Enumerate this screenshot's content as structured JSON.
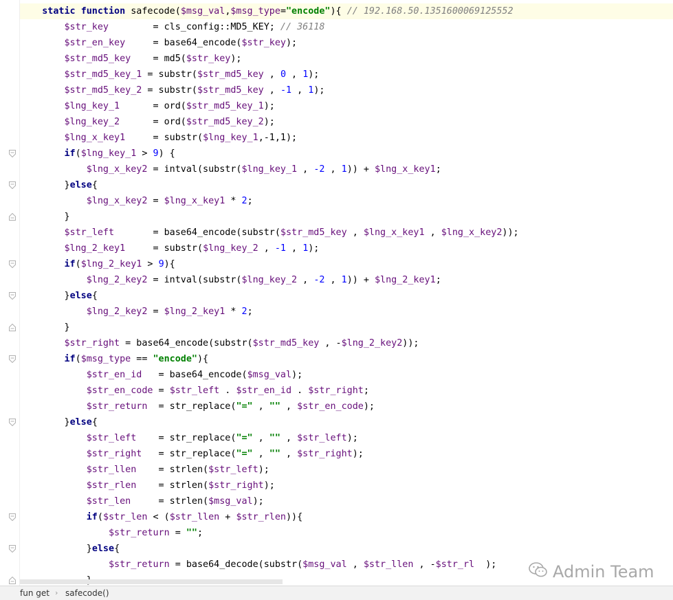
{
  "editor": {
    "lines": [
      {
        "indent": "    ",
        "tokens": [
          {
            "t": "static",
            "c": "kw"
          },
          {
            "t": " "
          },
          {
            "t": "function",
            "c": "kw"
          },
          {
            "t": " safecode("
          },
          {
            "t": "$msg_val",
            "c": "var"
          },
          {
            "t": ","
          },
          {
            "t": "$msg_type",
            "c": "var"
          },
          {
            "t": "="
          },
          {
            "t": "\"encode\"",
            "c": "str"
          },
          {
            "t": "){ "
          },
          {
            "t": "// 192.168.50.1351600069125552",
            "c": "cmt"
          }
        ]
      },
      {
        "indent": "        ",
        "tokens": [
          {
            "t": "$str_key",
            "c": "var"
          },
          {
            "t": "        = cls_config::MD5_KEY; "
          },
          {
            "t": "// 36118",
            "c": "cmt"
          }
        ]
      },
      {
        "indent": "        ",
        "tokens": [
          {
            "t": "$str_en_key",
            "c": "var"
          },
          {
            "t": "     = base64_encode("
          },
          {
            "t": "$str_key",
            "c": "var"
          },
          {
            "t": ");"
          }
        ]
      },
      {
        "indent": "        ",
        "tokens": [
          {
            "t": "$str_md5_key",
            "c": "var"
          },
          {
            "t": "    = md5("
          },
          {
            "t": "$str_key",
            "c": "var"
          },
          {
            "t": ");"
          }
        ]
      },
      {
        "indent": "        ",
        "tokens": [
          {
            "t": "$str_md5_key_1",
            "c": "var"
          },
          {
            "t": " = substr("
          },
          {
            "t": "$str_md5_key",
            "c": "var"
          },
          {
            "t": " , "
          },
          {
            "t": "0",
            "c": "num"
          },
          {
            "t": " , "
          },
          {
            "t": "1",
            "c": "num"
          },
          {
            "t": ");"
          }
        ]
      },
      {
        "indent": "        ",
        "tokens": [
          {
            "t": "$str_md5_key_2",
            "c": "var"
          },
          {
            "t": " = substr("
          },
          {
            "t": "$str_md5_key",
            "c": "var"
          },
          {
            "t": " , "
          },
          {
            "t": "-1",
            "c": "num"
          },
          {
            "t": " , "
          },
          {
            "t": "1",
            "c": "num"
          },
          {
            "t": ");"
          }
        ]
      },
      {
        "indent": "        ",
        "tokens": [
          {
            "t": "$lng_key_1",
            "c": "var"
          },
          {
            "t": "      = ord("
          },
          {
            "t": "$str_md5_key_1",
            "c": "var"
          },
          {
            "t": ");"
          }
        ]
      },
      {
        "indent": "        ",
        "tokens": [
          {
            "t": "$lng_key_2",
            "c": "var"
          },
          {
            "t": "      = ord("
          },
          {
            "t": "$str_md5_key_2",
            "c": "var"
          },
          {
            "t": ");"
          }
        ]
      },
      {
        "indent": "        ",
        "tokens": [
          {
            "t": "$lng_x_key1",
            "c": "var"
          },
          {
            "t": "     = substr("
          },
          {
            "t": "$lng_key_1",
            "c": "var"
          },
          {
            "t": ",-1,1);"
          }
        ]
      },
      {
        "indent": "        ",
        "fold": "open",
        "tokens": [
          {
            "t": "if",
            "c": "kw"
          },
          {
            "t": "("
          },
          {
            "t": "$lng_key_1",
            "c": "var"
          },
          {
            "t": " > "
          },
          {
            "t": "9",
            "c": "num"
          },
          {
            "t": ") {"
          }
        ]
      },
      {
        "indent": "            ",
        "tokens": [
          {
            "t": "$lng_x_key2",
            "c": "var"
          },
          {
            "t": " = intval(substr("
          },
          {
            "t": "$lng_key_1",
            "c": "var"
          },
          {
            "t": " , "
          },
          {
            "t": "-2",
            "c": "num"
          },
          {
            "t": " , "
          },
          {
            "t": "1",
            "c": "num"
          },
          {
            "t": ")) + "
          },
          {
            "t": "$lng_x_key1",
            "c": "var"
          },
          {
            "t": ";"
          }
        ]
      },
      {
        "indent": "        ",
        "fold": "open",
        "tokens": [
          {
            "t": "}"
          },
          {
            "t": "else",
            "c": "kw"
          },
          {
            "t": "{"
          }
        ]
      },
      {
        "indent": "            ",
        "tokens": [
          {
            "t": "$lng_x_key2",
            "c": "var"
          },
          {
            "t": " = "
          },
          {
            "t": "$lng_x_key1",
            "c": "var"
          },
          {
            "t": " * "
          },
          {
            "t": "2",
            "c": "num"
          },
          {
            "t": ";"
          }
        ]
      },
      {
        "indent": "        ",
        "fold": "close",
        "tokens": [
          {
            "t": "}"
          }
        ]
      },
      {
        "indent": "        ",
        "tokens": [
          {
            "t": "$str_left",
            "c": "var"
          },
          {
            "t": "       = base64_encode(substr("
          },
          {
            "t": "$str_md5_key",
            "c": "var"
          },
          {
            "t": " , "
          },
          {
            "t": "$lng_x_key1",
            "c": "var"
          },
          {
            "t": " , "
          },
          {
            "t": "$lng_x_key2",
            "c": "var"
          },
          {
            "t": "));"
          }
        ]
      },
      {
        "indent": "        ",
        "tokens": [
          {
            "t": "$lng_2_key1",
            "c": "var"
          },
          {
            "t": "     = substr("
          },
          {
            "t": "$lng_key_2",
            "c": "var"
          },
          {
            "t": " , "
          },
          {
            "t": "-1",
            "c": "num"
          },
          {
            "t": " , "
          },
          {
            "t": "1",
            "c": "num"
          },
          {
            "t": ");"
          }
        ]
      },
      {
        "indent": "        ",
        "fold": "open",
        "tokens": [
          {
            "t": "if",
            "c": "kw"
          },
          {
            "t": "("
          },
          {
            "t": "$lng_2_key1",
            "c": "var"
          },
          {
            "t": " > "
          },
          {
            "t": "9",
            "c": "num"
          },
          {
            "t": "){"
          }
        ]
      },
      {
        "indent": "            ",
        "tokens": [
          {
            "t": "$lng_2_key2",
            "c": "var"
          },
          {
            "t": " = intval(substr("
          },
          {
            "t": "$lng_key_2",
            "c": "var"
          },
          {
            "t": " , "
          },
          {
            "t": "-2",
            "c": "num"
          },
          {
            "t": " , "
          },
          {
            "t": "1",
            "c": "num"
          },
          {
            "t": ")) + "
          },
          {
            "t": "$lng_2_key1",
            "c": "var"
          },
          {
            "t": ";"
          }
        ]
      },
      {
        "indent": "        ",
        "fold": "open",
        "tokens": [
          {
            "t": "}"
          },
          {
            "t": "else",
            "c": "kw"
          },
          {
            "t": "{"
          }
        ]
      },
      {
        "indent": "            ",
        "tokens": [
          {
            "t": "$lng_2_key2",
            "c": "var"
          },
          {
            "t": " = "
          },
          {
            "t": "$lng_2_key1",
            "c": "var"
          },
          {
            "t": " * "
          },
          {
            "t": "2",
            "c": "num"
          },
          {
            "t": ";"
          }
        ]
      },
      {
        "indent": "        ",
        "fold": "close",
        "tokens": [
          {
            "t": "}"
          }
        ]
      },
      {
        "indent": "        ",
        "tokens": [
          {
            "t": "$str_right",
            "c": "var"
          },
          {
            "t": " = base64_encode(substr("
          },
          {
            "t": "$str_md5_key",
            "c": "var"
          },
          {
            "t": " , -"
          },
          {
            "t": "$lng_2_key2",
            "c": "var"
          },
          {
            "t": "));"
          }
        ]
      },
      {
        "indent": "        ",
        "fold": "open",
        "tokens": [
          {
            "t": "if",
            "c": "kw"
          },
          {
            "t": "("
          },
          {
            "t": "$msg_type",
            "c": "var"
          },
          {
            "t": " == "
          },
          {
            "t": "\"encode\"",
            "c": "str"
          },
          {
            "t": "){"
          }
        ]
      },
      {
        "indent": "            ",
        "tokens": [
          {
            "t": "$str_en_id",
            "c": "var"
          },
          {
            "t": "   = base64_encode("
          },
          {
            "t": "$msg_val",
            "c": "var"
          },
          {
            "t": ");"
          }
        ]
      },
      {
        "indent": "            ",
        "tokens": [
          {
            "t": "$str_en_code",
            "c": "var"
          },
          {
            "t": " = "
          },
          {
            "t": "$str_left",
            "c": "var"
          },
          {
            "t": " . "
          },
          {
            "t": "$str_en_id",
            "c": "var"
          },
          {
            "t": " . "
          },
          {
            "t": "$str_right",
            "c": "var"
          },
          {
            "t": ";"
          }
        ]
      },
      {
        "indent": "            ",
        "tokens": [
          {
            "t": "$str_return",
            "c": "var"
          },
          {
            "t": "  = str_replace("
          },
          {
            "t": "\"=\"",
            "c": "str"
          },
          {
            "t": " , "
          },
          {
            "t": "\"\"",
            "c": "str"
          },
          {
            "t": " , "
          },
          {
            "t": "$str_en_code",
            "c": "var"
          },
          {
            "t": ");"
          }
        ]
      },
      {
        "indent": "        ",
        "fold": "open",
        "tokens": [
          {
            "t": "}"
          },
          {
            "t": "else",
            "c": "kw"
          },
          {
            "t": "{"
          }
        ]
      },
      {
        "indent": "            ",
        "tokens": [
          {
            "t": "$str_left",
            "c": "var"
          },
          {
            "t": "    = str_replace("
          },
          {
            "t": "\"=\"",
            "c": "str"
          },
          {
            "t": " , "
          },
          {
            "t": "\"\"",
            "c": "str"
          },
          {
            "t": " , "
          },
          {
            "t": "$str_left",
            "c": "var"
          },
          {
            "t": ");"
          }
        ]
      },
      {
        "indent": "            ",
        "tokens": [
          {
            "t": "$str_right",
            "c": "var"
          },
          {
            "t": "   = str_replace("
          },
          {
            "t": "\"=\"",
            "c": "str"
          },
          {
            "t": " , "
          },
          {
            "t": "\"\"",
            "c": "str"
          },
          {
            "t": " , "
          },
          {
            "t": "$str_right",
            "c": "var"
          },
          {
            "t": ");"
          }
        ]
      },
      {
        "indent": "            ",
        "tokens": [
          {
            "t": "$str_llen",
            "c": "var"
          },
          {
            "t": "    = strlen("
          },
          {
            "t": "$str_left",
            "c": "var"
          },
          {
            "t": ");"
          }
        ]
      },
      {
        "indent": "            ",
        "tokens": [
          {
            "t": "$str_rlen",
            "c": "var"
          },
          {
            "t": "    = strlen("
          },
          {
            "t": "$str_right",
            "c": "var"
          },
          {
            "t": ");"
          }
        ]
      },
      {
        "indent": "            ",
        "tokens": [
          {
            "t": "$str_len",
            "c": "var"
          },
          {
            "t": "     = strlen("
          },
          {
            "t": "$msg_val",
            "c": "var"
          },
          {
            "t": ");"
          }
        ]
      },
      {
        "indent": "            ",
        "fold": "open",
        "tokens": [
          {
            "t": "if",
            "c": "kw"
          },
          {
            "t": "("
          },
          {
            "t": "$str_len",
            "c": "var"
          },
          {
            "t": " < ("
          },
          {
            "t": "$str_llen",
            "c": "var"
          },
          {
            "t": " + "
          },
          {
            "t": "$str_rlen",
            "c": "var"
          },
          {
            "t": ")){"
          }
        ]
      },
      {
        "indent": "                ",
        "tokens": [
          {
            "t": "$str_return",
            "c": "var"
          },
          {
            "t": " = "
          },
          {
            "t": "\"\"",
            "c": "str"
          },
          {
            "t": ";"
          }
        ]
      },
      {
        "indent": "            ",
        "fold": "open",
        "tokens": [
          {
            "t": "}"
          },
          {
            "t": "else",
            "c": "kw"
          },
          {
            "t": "{"
          }
        ]
      },
      {
        "indent": "                ",
        "tokens": [
          {
            "t": "$str_return",
            "c": "var"
          },
          {
            "t": " = base64_decode(substr("
          },
          {
            "t": "$msg_val",
            "c": "var"
          },
          {
            "t": " , "
          },
          {
            "t": "$str_llen",
            "c": "var"
          },
          {
            "t": " , -"
          },
          {
            "t": "$str_rl",
            "c": "var"
          },
          {
            "t": "  );"
          }
        ]
      },
      {
        "indent": "            ",
        "fold": "close",
        "tokens": [
          {
            "t": "}"
          }
        ]
      }
    ]
  },
  "statusbar": {
    "crumbs": [
      "fun get",
      "safecode()"
    ],
    "separator": "›"
  },
  "watermark": {
    "text": "Admin Team",
    "icon": "wechat-icon"
  },
  "colors": {
    "keyword": "#000080",
    "variable": "#660e7a",
    "string": "#008000",
    "number": "#0000ff",
    "comment": "#808080",
    "current_line": "#fefde6"
  }
}
